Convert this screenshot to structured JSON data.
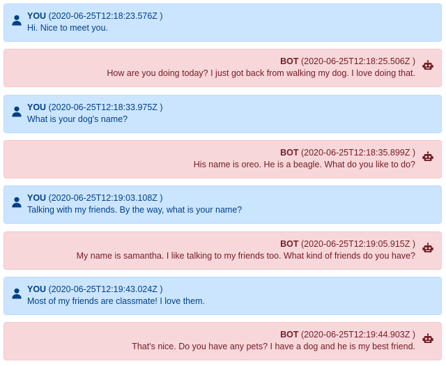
{
  "messages": [
    {
      "role": "user",
      "sender": "YOU",
      "timestamp": "2020-06-25T12:18:23.576Z",
      "text": "Hi. Nice to meet you."
    },
    {
      "role": "bot",
      "sender": "BOT",
      "timestamp": "2020-06-25T12:18:25.506Z",
      "text": "How are you doing today? I just got back from walking my dog. I love doing that."
    },
    {
      "role": "user",
      "sender": "YOU",
      "timestamp": "2020-06-25T12:18:33.975Z",
      "text": "What is your dog's name?"
    },
    {
      "role": "bot",
      "sender": "BOT",
      "timestamp": "2020-06-25T12:18:35.899Z",
      "text": "His name is oreo. He is a beagle. What do you like to do?"
    },
    {
      "role": "user",
      "sender": "YOU",
      "timestamp": "2020-06-25T12:19:03.108Z",
      "text": "Talking with my friends. By the way, what is your name?"
    },
    {
      "role": "bot",
      "sender": "BOT",
      "timestamp": "2020-06-25T12:19:05.915Z",
      "text": "My name is samantha. I like talking to my friends too. What kind of friends do you have?"
    },
    {
      "role": "user",
      "sender": "YOU",
      "timestamp": "2020-06-25T12:19:43.024Z",
      "text": "Most of my friends are classmate! I love them."
    },
    {
      "role": "bot",
      "sender": "BOT",
      "timestamp": "2020-06-25T12:19:44.903Z",
      "text": "That's nice. Do you have any pets? I have a dog and he is my best friend."
    }
  ],
  "icons": {
    "user": "user-icon",
    "bot": "robot-icon"
  },
  "colors": {
    "user_bg": "#cce5ff",
    "user_text": "#004085",
    "bot_bg": "#f8d7da",
    "bot_text": "#721c24"
  },
  "format": {
    "ts_open": " (",
    "ts_close": " )"
  }
}
